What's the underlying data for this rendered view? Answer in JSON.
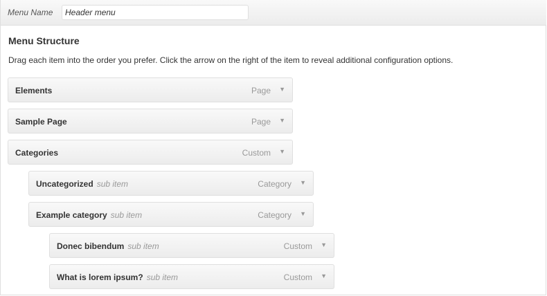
{
  "header": {
    "menu_name_label": "Menu Name",
    "menu_name_value": "Header menu"
  },
  "structure": {
    "title": "Menu Structure",
    "instructions": "Drag each item into the order you prefer. Click the arrow on the right of the item to reveal additional configuration options."
  },
  "items": [
    {
      "title": "Elements",
      "sub": "",
      "type": "Page",
      "arrow": "▼"
    },
    {
      "title": "Sample Page",
      "sub": "",
      "type": "Page",
      "arrow": "▼"
    },
    {
      "title": "Categories",
      "sub": "",
      "type": "Custom",
      "arrow": "▼"
    },
    {
      "title": "Uncategorized",
      "sub": "sub item",
      "type": "Category",
      "arrow": "▼"
    },
    {
      "title": "Example category",
      "sub": "sub item",
      "type": "Category",
      "arrow": "▼"
    },
    {
      "title": "Donec bibendum",
      "sub": "sub item",
      "type": "Custom",
      "arrow": "▼"
    },
    {
      "title": "What is lorem ipsum?",
      "sub": "sub item",
      "type": "Custom",
      "arrow": "▼"
    }
  ]
}
